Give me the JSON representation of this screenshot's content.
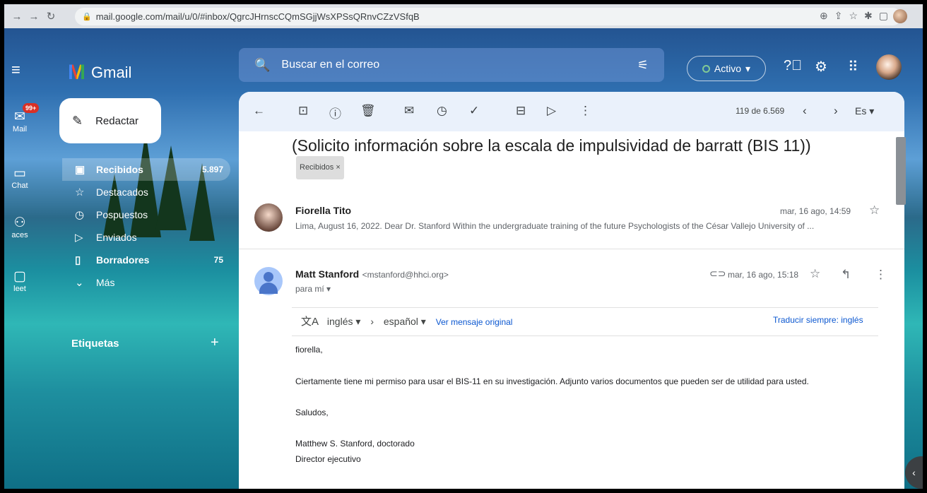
{
  "browser": {
    "url": "mail.google.com/mail/u/0/#inbox/QgrcJHrnscCQmSGjjWsXPSsQRnvCZzVSfqB"
  },
  "header": {
    "app_name": "Gmail",
    "search_placeholder": "Buscar en el correo",
    "status_label": "Activo"
  },
  "left_rail": {
    "mail_label": "Mail",
    "mail_badge": "99+",
    "chat_label": "Chat",
    "spaces_label": "aces",
    "meet_label": "leet"
  },
  "sidebar": {
    "compose_label": "Redactar",
    "items": [
      {
        "label": "Recibidos",
        "count": "5.897",
        "icon": "inbox-icon"
      },
      {
        "label": "Destacados",
        "count": "",
        "icon": "star-icon"
      },
      {
        "label": "Pospuestos",
        "count": "",
        "icon": "clock-icon"
      },
      {
        "label": "Enviados",
        "count": "",
        "icon": "send-icon"
      },
      {
        "label": "Borradores",
        "count": "75",
        "icon": "file-icon"
      },
      {
        "label": "Más",
        "count": "",
        "icon": "chevron-down-icon"
      }
    ],
    "labels_heading": "Etiquetas"
  },
  "toolbar": {
    "position": "119 de 6.569",
    "language": "Es"
  },
  "thread": {
    "subject": "(Solicito información sobre la escala de impulsividad de barratt (BIS 11))",
    "subject_chip": "Recibidos ×",
    "message1": {
      "sender": "Fiorella Tito",
      "date": "mar, 16 ago, 14:59",
      "snippet": "Lima, August 16, 2022. Dear Dr. Stanford Within the undergraduate training of the future Psychologists of the César Vallejo University of ..."
    },
    "message2": {
      "sender": "Matt Stanford",
      "email": "<mstanford@hhci.org>",
      "to": "para mí ▾",
      "date": "mar, 16 ago, 15:18",
      "translate": {
        "from": "inglés",
        "to": "español",
        "view_original": "Ver mensaje original",
        "always": "Traducir siempre: inglés"
      },
      "body": {
        "greeting": "fiorella,",
        "line1": "Ciertamente tiene mi permiso para usar el BIS-11 en su investigación. Adjunto varios documentos que pueden ser de utilidad para usted.",
        "closing": "Saludos,",
        "signature1": "Matthew S. Stanford, doctorado",
        "signature2": "Director ejecutivo"
      }
    }
  },
  "colors": {
    "accent_blue": "#0b57d0",
    "badge_red": "#d93025",
    "toolbar_bg": "#eaf1fb"
  }
}
